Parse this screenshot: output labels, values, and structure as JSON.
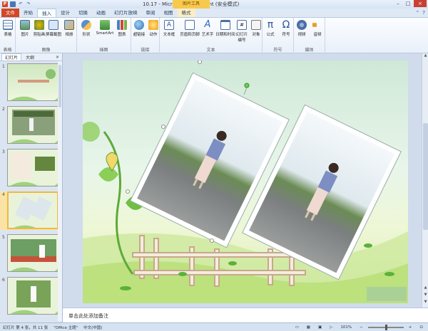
{
  "window": {
    "title": "10.17 - Microsoft PowerPoint (安全模式)",
    "context_tab_group": "图片工具",
    "minimize": "–",
    "maximize": "□",
    "close": "×"
  },
  "tabs": [
    {
      "label": "文件"
    },
    {
      "label": "开始"
    },
    {
      "label": "插入"
    },
    {
      "label": "设计"
    },
    {
      "label": "切换"
    },
    {
      "label": "动画"
    },
    {
      "label": "幻灯片放映"
    },
    {
      "label": "审阅"
    },
    {
      "label": "视图"
    },
    {
      "label": "格式"
    }
  ],
  "ribbon": {
    "groups": [
      {
        "name": "表格",
        "buttons": [
          {
            "label": "表格"
          }
        ]
      },
      {
        "name": "图像",
        "buttons": [
          {
            "label": "图片"
          },
          {
            "label": "剪贴画"
          },
          {
            "label": "屏幕截图"
          },
          {
            "label": "相册"
          }
        ]
      },
      {
        "name": "插图",
        "buttons": [
          {
            "label": "形状"
          },
          {
            "label": "SmartArt"
          },
          {
            "label": "图表"
          }
        ]
      },
      {
        "name": "链接",
        "buttons": [
          {
            "label": "超链接"
          },
          {
            "label": "动作"
          }
        ]
      },
      {
        "name": "文本",
        "buttons": [
          {
            "label": "文本框"
          },
          {
            "label": "页眉和页脚"
          },
          {
            "label": "艺术字"
          },
          {
            "label": "日期和时间"
          },
          {
            "label": "幻灯片",
            "label2": "编号"
          },
          {
            "label": "对象"
          }
        ]
      },
      {
        "name": "符号",
        "buttons": [
          {
            "label": "公式"
          },
          {
            "label": "符号"
          }
        ]
      },
      {
        "name": "媒体",
        "buttons": [
          {
            "label": "视频"
          },
          {
            "label": "音频"
          }
        ]
      }
    ]
  },
  "panel": {
    "tabs": [
      "幻灯片",
      "大纲"
    ],
    "close": "×",
    "slides": [
      {
        "num": "1"
      },
      {
        "num": "2"
      },
      {
        "num": "3"
      },
      {
        "num": "4"
      },
      {
        "num": "5"
      },
      {
        "num": "6"
      }
    ]
  },
  "notes": {
    "placeholder": "单击此处添加备注"
  },
  "status": {
    "slide_info": "幻灯片 第 4 张，共 11 张",
    "theme": "\"Office 主题\"",
    "language": "中文(中国)",
    "zoom": "101%"
  },
  "colors": {
    "file_tab": "#d24726",
    "accent": "#2a5595",
    "context_tab": "#f7c94f"
  }
}
